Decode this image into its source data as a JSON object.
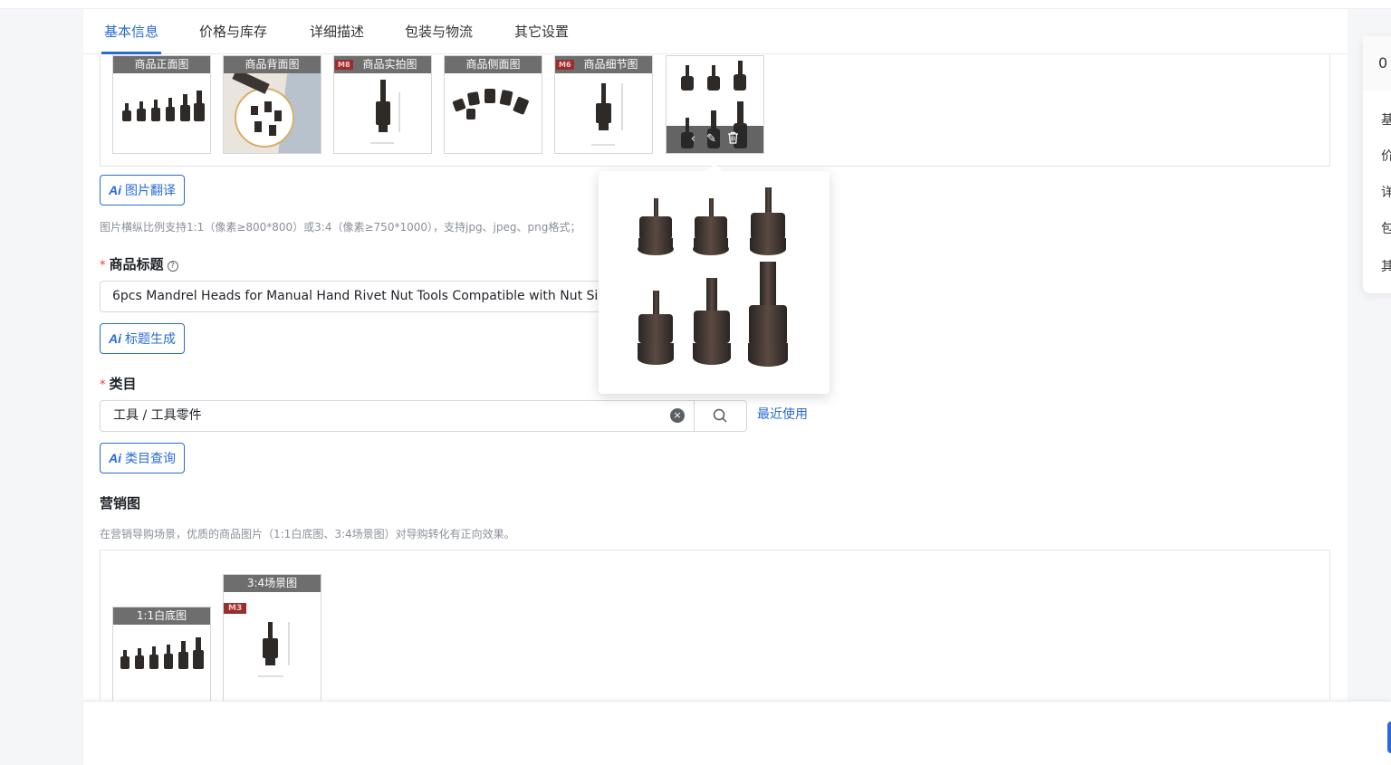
{
  "tabs": [
    "基本信息",
    "价格与库存",
    "详细描述",
    "包装与物流",
    "其它设置"
  ],
  "images": [
    {
      "caption": "商品正面图",
      "tag": ""
    },
    {
      "caption": "商品背面图",
      "tag": ""
    },
    {
      "caption": "商品实拍图",
      "tag": "M8"
    },
    {
      "caption": "商品侧面图",
      "tag": ""
    },
    {
      "caption": "商品细节图",
      "tag": "M6"
    }
  ],
  "image_actions": {
    "prev": "‹",
    "edit": "✎",
    "delete": "🗑"
  },
  "ai_image_translate": "图片翻译",
  "ai_badge": "Ai",
  "image_hint": "图片横纵比例支持1:1（像素≥800*800）或3:4（像素≥750*1000），支持jpg、jpeg、png格式；",
  "title_section": {
    "required": "*",
    "label": "商品标题",
    "help": "?",
    "value": "6pcs Mandrel Heads for Manual Hand Rivet Nut Tools Compatible with Nut Size",
    "ai_button": "标题生成"
  },
  "category_section": {
    "required": "*",
    "label": "类目",
    "value": "工具 / 工具零件",
    "recent_link": "最近使用",
    "ai_button": "类目查询"
  },
  "marketing_section": {
    "label": "营销图",
    "hint": "在营销导购场景，优质的商品图片（1:1白底图、3:4场景图）对导购转化有正向效果。",
    "images": [
      {
        "caption": "1:1白底图",
        "tag": ""
      },
      {
        "caption": "3:4场景图",
        "tag": "M3"
      }
    ]
  },
  "side_nav": {
    "number": "0",
    "items": [
      "基",
      "价",
      "详",
      "包",
      "其"
    ]
  },
  "colors": {
    "accent": "#2a6bd8",
    "required": "#e53935"
  }
}
